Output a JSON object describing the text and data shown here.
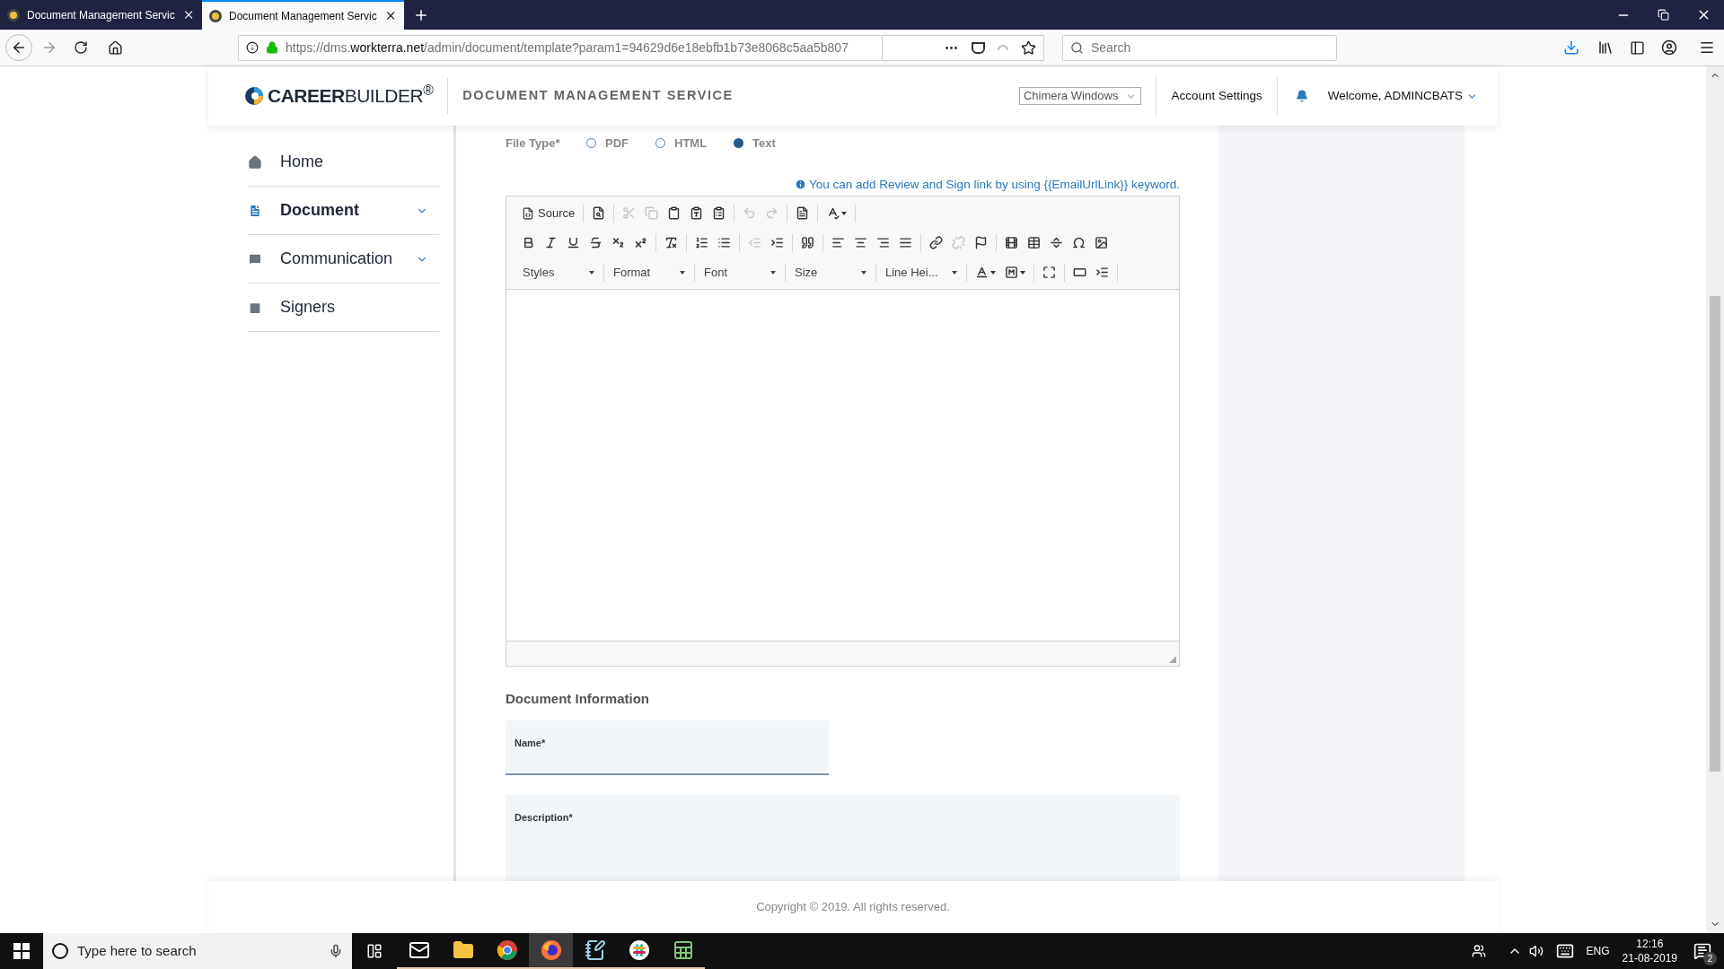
{
  "browser": {
    "tabs": [
      {
        "title": "Document Management Servic",
        "selected": false
      },
      {
        "title": "Document Management Servic",
        "selected": true
      }
    ],
    "url": {
      "scheme": "https://dms.",
      "domain": "workterra.net",
      "path": "/admin/document/template?param1=94629d6e18ebfb1b73e8068c5aa5b807"
    },
    "search": {
      "placeholder": "Search"
    }
  },
  "header": {
    "logo": "**CAREER**BUILDER$^{®}$",
    "service_title": "DOCUMENT MANAGEMENT SERVICE",
    "company_select": "Chimera Windows",
    "account_settings": "Account Settings",
    "welcome": "Welcome, ADMINCBATS"
  },
  "sidebar": {
    "items": [
      {
        "label": "Home",
        "kind": "home",
        "selected": false,
        "has_submenu": false
      },
      {
        "label": "Document",
        "kind": "document",
        "selected": true,
        "has_submenu": true
      },
      {
        "label": "Communication",
        "kind": "communication",
        "selected": false,
        "has_submenu": true
      },
      {
        "label": "Signers",
        "kind": "signers",
        "selected": false,
        "has_submenu": false
      }
    ]
  },
  "file_type": {
    "label": "File Type*",
    "options": [
      {
        "label": "PDF",
        "selected": false
      },
      {
        "label": "HTML",
        "selected": false
      },
      {
        "label": "Text",
        "selected": true
      }
    ]
  },
  "hint": "You can add Review and Sign link by using {{EmailUrlLink}} keyword.",
  "editor": {
    "toolbar_rows": [
      [
        {
          "kind": "source",
          "label": "Source",
          "disabled": false
        },
        {
          "kind": "separator"
        },
        {
          "kind": "preview",
          "disabled": false
        },
        {
          "kind": "separator"
        },
        {
          "kind": "cut",
          "disabled": true
        },
        {
          "kind": "copy",
          "disabled": true
        },
        {
          "kind": "paste",
          "disabled": false
        },
        {
          "kind": "pastetext",
          "disabled": false
        },
        {
          "kind": "pasteword",
          "disabled": false
        },
        {
          "kind": "separator"
        },
        {
          "kind": "undo",
          "disabled": true
        },
        {
          "kind": "redo",
          "disabled": true
        },
        {
          "kind": "separator"
        },
        {
          "kind": "template",
          "disabled": false
        },
        {
          "kind": "separator"
        },
        {
          "kind": "spellcheck",
          "disabled": false
        },
        {
          "kind": "separator"
        }
      ],
      [
        {
          "kind": "bold",
          "disabled": false
        },
        {
          "kind": "italic",
          "disabled": false
        },
        {
          "kind": "underline",
          "disabled": false
        },
        {
          "kind": "strike",
          "disabled": false
        },
        {
          "kind": "subscript",
          "disabled": false
        },
        {
          "kind": "superscript",
          "disabled": false
        },
        {
          "kind": "separator"
        },
        {
          "kind": "removeformat",
          "disabled": false
        },
        {
          "kind": "separator"
        },
        {
          "kind": "numberedlist",
          "disabled": false
        },
        {
          "kind": "bulletlist",
          "disabled": false
        },
        {
          "kind": "separator"
        },
        {
          "kind": "outdent",
          "disabled": true
        },
        {
          "kind": "indent",
          "disabled": false
        },
        {
          "kind": "separator"
        },
        {
          "kind": "blockquote",
          "disabled": false
        },
        {
          "kind": "separator"
        },
        {
          "kind": "alignleft",
          "disabled": false
        },
        {
          "kind": "aligncenter",
          "disabled": false
        },
        {
          "kind": "alignright",
          "disabled": false
        },
        {
          "kind": "justify",
          "disabled": false
        },
        {
          "kind": "separator"
        },
        {
          "kind": "link",
          "disabled": false
        },
        {
          "kind": "unlink",
          "disabled": true
        },
        {
          "kind": "anchor",
          "disabled": false
        },
        {
          "kind": "separator"
        },
        {
          "kind": "media",
          "disabled": false
        },
        {
          "kind": "table",
          "disabled": false
        },
        {
          "kind": "hrule",
          "disabled": false
        },
        {
          "kind": "specialchar",
          "disabled": false
        },
        {
          "kind": "image",
          "disabled": false
        }
      ],
      [
        {
          "kind": "dropdown",
          "label": "Styles"
        },
        {
          "kind": "separator"
        },
        {
          "kind": "dropdown",
          "label": "Format"
        },
        {
          "kind": "separator"
        },
        {
          "kind": "dropdown",
          "label": "Font"
        },
        {
          "kind": "separator"
        },
        {
          "kind": "dropdown",
          "label": "Size"
        },
        {
          "kind": "separator"
        },
        {
          "kind": "dropdown",
          "label": "Line Hei..."
        },
        {
          "kind": "separator"
        },
        {
          "kind": "textcolor",
          "disabled": false
        },
        {
          "kind": "bgcolor",
          "disabled": false
        },
        {
          "kind": "separator"
        },
        {
          "kind": "maximize",
          "disabled": false
        },
        {
          "kind": "separator"
        },
        {
          "kind": "field",
          "disabled": false
        },
        {
          "kind": "lineheight",
          "disabled": false
        },
        {
          "kind": "separator"
        }
      ]
    ]
  },
  "document_information": {
    "heading": "Document Information",
    "name_label": "Name*",
    "description_label": "Description*"
  },
  "footer": "Copyright © 2019. All rights reserved.",
  "taskbar": {
    "search_placeholder": "Type here to search",
    "apps": [
      {
        "kind": "mail",
        "selected": false
      },
      {
        "kind": "folder",
        "selected": false
      },
      {
        "kind": "chrome",
        "selected": false
      },
      {
        "kind": "firefox",
        "selected": true
      },
      {
        "kind": "notepad",
        "selected": false
      },
      {
        "kind": "slack",
        "selected": false
      },
      {
        "kind": "sheet",
        "selected": false
      }
    ],
    "language": "ENG",
    "time": "12:16",
    "date": "21-08-2019",
    "notifications": "2"
  }
}
